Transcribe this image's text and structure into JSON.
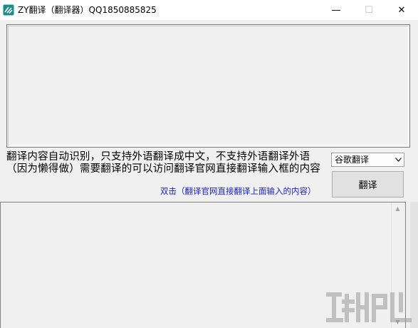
{
  "window": {
    "title": "ZY翻译（翻译器）QQ1850885825",
    "minimize_glyph": "—",
    "maximize_glyph": "☐",
    "close_glyph": "✕",
    "icon": "app-logo-icon"
  },
  "input": {
    "value": ""
  },
  "info": {
    "text": "翻译内容自动识别，只支持外语翻译成中文，不支持外语翻译外语（因为懒得做）需要翻译的可以访问翻译官网直接翻译输入框的内容",
    "double_click_note": "双击（翻译官网直接翻译上面输入的内容）"
  },
  "engine_select": {
    "selected": "谷歌翻译",
    "icon": "chevron-down-icon"
  },
  "translate_button": {
    "label": "翻译"
  },
  "output": {
    "value": ""
  },
  "colors": {
    "note_blue": "#1c23c8",
    "background": "#f0f0f0"
  }
}
